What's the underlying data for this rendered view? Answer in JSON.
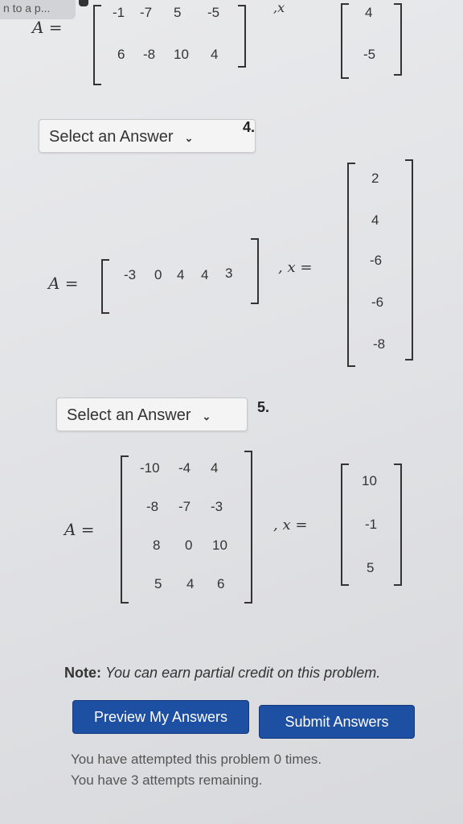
{
  "header": {
    "tab_title": "n to a p..."
  },
  "problem3": {
    "a_label": "A =",
    "row1": [
      "-1",
      "-7",
      "5",
      "-5"
    ],
    "row2": [
      "6",
      "-8",
      "10",
      "4"
    ],
    "x_label": ",x",
    "x_vector": [
      "4",
      "-5"
    ]
  },
  "problem4": {
    "select_label": "Select an Answer",
    "number": "4.",
    "a_label": "A =",
    "a_row": [
      "-3",
      "0",
      "4",
      "4",
      "3"
    ],
    "x_label": ", x =",
    "x_vector": [
      "2",
      "4",
      "-6",
      "-6",
      "-8"
    ]
  },
  "problem5": {
    "select_label": "Select an Answer",
    "number": "5.",
    "a_label": "A =",
    "a_rows": [
      [
        "-10",
        "-4",
        "4"
      ],
      [
        "-8",
        "-7",
        "-3"
      ],
      [
        "8",
        "0",
        "10"
      ],
      [
        "5",
        "4",
        "6"
      ]
    ],
    "x_label": ", x =",
    "x_vector": [
      "10",
      "-1",
      "5"
    ]
  },
  "footer": {
    "note_label": "Note:",
    "note_text": "You can earn partial credit on this problem.",
    "preview_button": "Preview My Answers",
    "submit_button": "Submit Answers",
    "attempts_line1": "You have attempted this problem 0 times.",
    "attempts_line2": "You have 3 attempts remaining."
  },
  "colors": {
    "button_blue": "#1d4fa3"
  },
  "icons": {
    "dropdown": "chevron-down-icon"
  }
}
